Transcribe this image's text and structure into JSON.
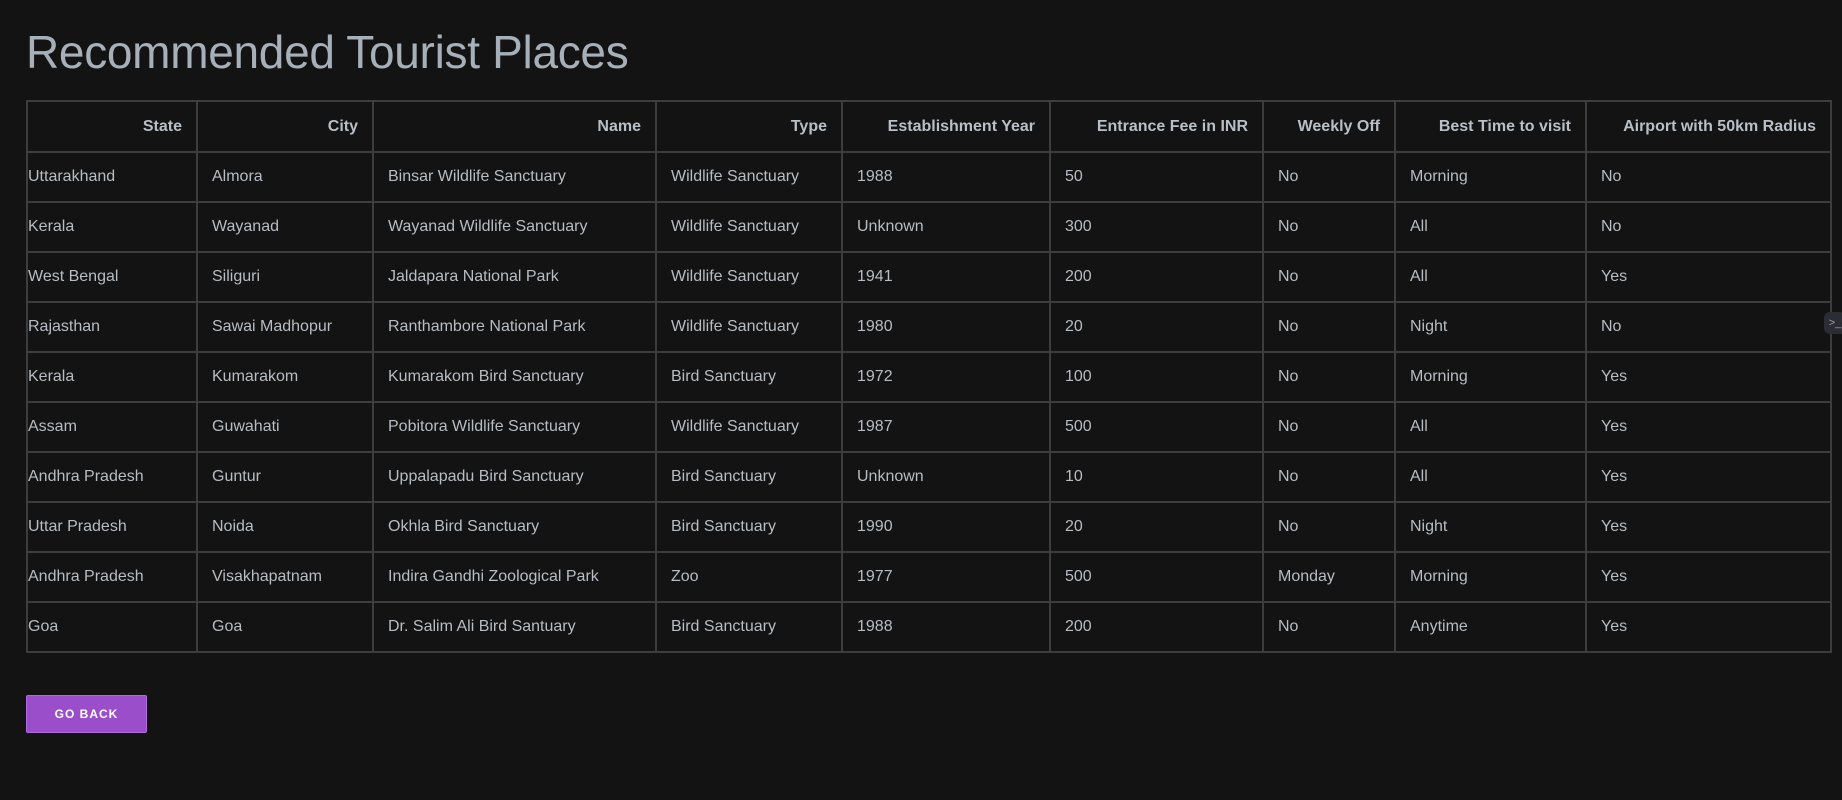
{
  "page": {
    "title": "Recommended Tourist Places"
  },
  "table": {
    "headers": [
      "State",
      "City",
      "Name",
      "Type",
      "Establishment Year",
      "Entrance Fee in INR",
      "Weekly Off",
      "Best Time to visit",
      "Airport with 50km Radius"
    ],
    "rows": [
      [
        "Uttarakhand",
        "Almora",
        "Binsar Wildlife Sanctuary",
        "Wildlife Sanctuary",
        "1988",
        "50",
        "No",
        "Morning",
        "No"
      ],
      [
        "Kerala",
        "Wayanad",
        "Wayanad Wildlife Sanctuary",
        "Wildlife Sanctuary",
        "Unknown",
        "300",
        "No",
        "All",
        "No"
      ],
      [
        "West Bengal",
        "Siliguri",
        "Jaldapara National Park",
        "Wildlife Sanctuary",
        "1941",
        "200",
        "No",
        "All",
        "Yes"
      ],
      [
        "Rajasthan",
        "Sawai Madhopur",
        "Ranthambore National Park",
        "Wildlife Sanctuary",
        "1980",
        "20",
        "No",
        "Night",
        "No"
      ],
      [
        "Kerala",
        "Kumarakom",
        "Kumarakom Bird Sanctuary",
        "Bird Sanctuary",
        "1972",
        "100",
        "No",
        "Morning",
        "Yes"
      ],
      [
        "Assam",
        "Guwahati",
        "Pobitora Wildlife Sanctuary",
        "Wildlife Sanctuary",
        "1987",
        "500",
        "No",
        "All",
        "Yes"
      ],
      [
        "Andhra Pradesh",
        "Guntur",
        "Uppalapadu Bird Sanctuary",
        "Bird Sanctuary",
        "Unknown",
        "10",
        "No",
        "All",
        "Yes"
      ],
      [
        "Uttar Pradesh",
        "Noida",
        "Okhla Bird Sanctuary",
        "Bird Sanctuary",
        "1990",
        "20",
        "No",
        "Night",
        "Yes"
      ],
      [
        "Andhra Pradesh",
        "Visakhapatnam",
        "Indira Gandhi Zoological Park",
        "Zoo",
        "1977",
        "500",
        "Monday",
        "Morning",
        "Yes"
      ],
      [
        "Goa",
        "Goa",
        "Dr. Salim Ali Bird Santuary",
        "Bird Sanctuary",
        "1988",
        "200",
        "No",
        "Anytime",
        "Yes"
      ]
    ]
  },
  "actions": {
    "go_back_label": "GO BACK"
  },
  "side_handle": {
    "icon": "terminal-icon",
    "glyph": ">_"
  },
  "colors": {
    "background": "#131313",
    "accent": "#9b4ec9",
    "text": "#b7bdc3",
    "border": "#3d3d3d"
  }
}
